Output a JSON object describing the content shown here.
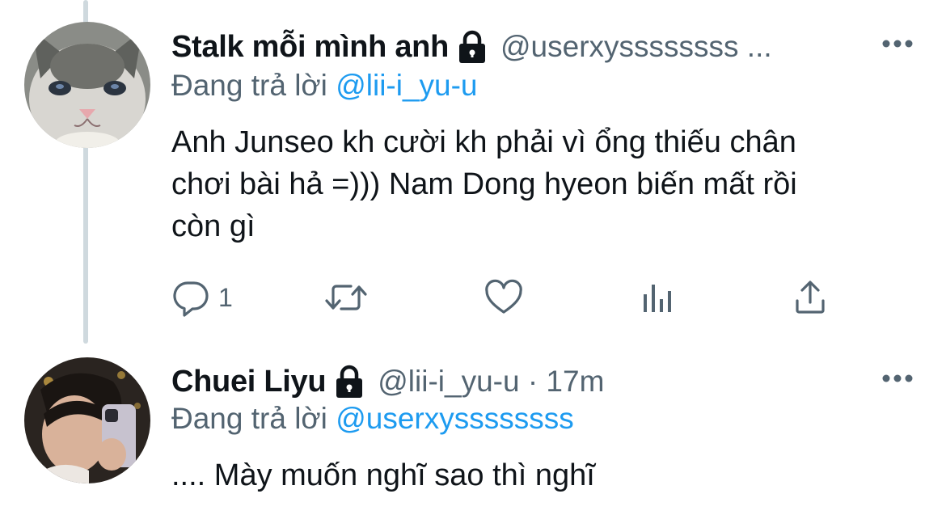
{
  "tweets": [
    {
      "display_name": "Stalk mỗi mình anh",
      "handle": "@userxyssssssss ...",
      "replying_label": "Đang trả lời",
      "replying_to": "@lii-i_yu-u",
      "text_lines": [
        "Anh Junseo kh cười kh phải vì ổng thiếu chân",
        "chơi bài hả =))) Nam Dong hyeon biến mất rồi",
        "còn gì"
      ],
      "reply_count": "1",
      "icons": {
        "lock": "lock-icon",
        "more": "more-icon",
        "reply": "reply-icon",
        "retweet": "retweet-icon",
        "like": "like-icon",
        "analytics": "analytics-icon",
        "share": "share-icon"
      }
    },
    {
      "display_name": "Chuei Liyu",
      "handle": "@lii-i_yu-u · 17m",
      "replying_label": "Đang trả lời",
      "replying_to": "@userxyssssssss",
      "text_lines": [
        ".... Mày muốn nghĩ sao thì nghĩ"
      ]
    }
  ],
  "colors": {
    "text": "#0f1419",
    "secondary": "#536471",
    "accent": "#1d9bf0",
    "thread_line": "#cfd9de"
  }
}
